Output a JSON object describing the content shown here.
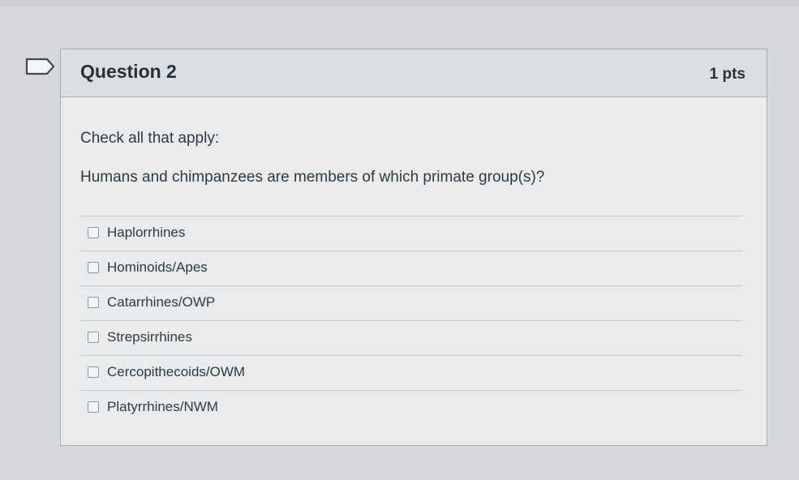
{
  "question": {
    "title": "Question 2",
    "points": "1 pts",
    "instruction": "Check all that apply:",
    "prompt": "Humans and chimpanzees are members of which primate group(s)?",
    "answers": [
      {
        "label": "Haplorrhines",
        "checked": false
      },
      {
        "label": "Hominoids/Apes",
        "checked": false
      },
      {
        "label": "Catarrhines/OWP",
        "checked": false
      },
      {
        "label": "Strepsirrhines",
        "checked": false
      },
      {
        "label": "Cercopithecoids/OWM",
        "checked": false
      },
      {
        "label": "Platyrrhines/NWM",
        "checked": false
      }
    ]
  }
}
